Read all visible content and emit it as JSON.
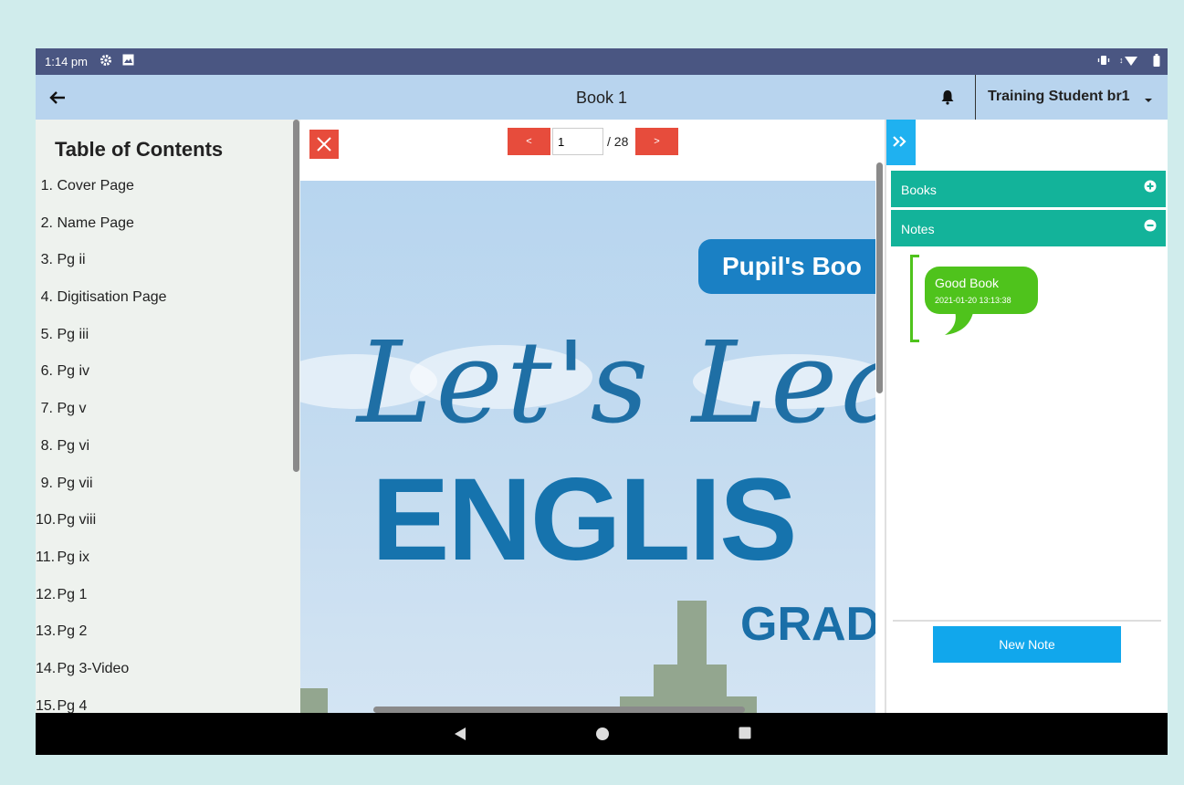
{
  "status_bar": {
    "time": "1:14 pm"
  },
  "app_bar": {
    "title": "Book 1",
    "user": "Training Student br1"
  },
  "toc": {
    "heading": "Table of Contents",
    "items": [
      {
        "num": "1.",
        "label": "Cover Page"
      },
      {
        "num": "2.",
        "label": "Name Page"
      },
      {
        "num": "3.",
        "label": "Pg ii"
      },
      {
        "num": "4.",
        "label": "Digitisation Page"
      },
      {
        "num": "5.",
        "label": "Pg iii"
      },
      {
        "num": "6.",
        "label": "Pg iv"
      },
      {
        "num": "7.",
        "label": "Pg v"
      },
      {
        "num": "8.",
        "label": "Pg vi"
      },
      {
        "num": "9.",
        "label": "Pg vii"
      },
      {
        "num": "10.",
        "label": "Pg viii"
      },
      {
        "num": "11.",
        "label": "Pg ix"
      },
      {
        "num": "12.",
        "label": "Pg 1"
      },
      {
        "num": "13.",
        "label": "Pg 2"
      },
      {
        "num": "14.",
        "label": "Pg 3-Video"
      },
      {
        "num": "15.",
        "label": "Pg 4"
      }
    ]
  },
  "viewer": {
    "prev_label": "<",
    "next_label": ">",
    "current_page": "1",
    "total_pages": "/ 28",
    "page_content": {
      "badge": "Pupil's Boo",
      "script_title": "Let's Lear",
      "main_title": "ENGLIS",
      "grade": "GRAD"
    }
  },
  "side_panel": {
    "sections": [
      {
        "label": "Books",
        "state": "collapsed"
      },
      {
        "label": "Notes",
        "state": "expanded"
      }
    ],
    "note": {
      "title": "Good Book",
      "date": "2021-01-20 13:13:38"
    },
    "new_note_label": "New Note"
  },
  "colors": {
    "accent_red": "#e74c3c",
    "teal": "#13b39a",
    "note_green": "#4fc31c",
    "button_blue": "#11a7ec",
    "status_bar": "#4a5682",
    "app_bar": "#b8d4ee"
  }
}
